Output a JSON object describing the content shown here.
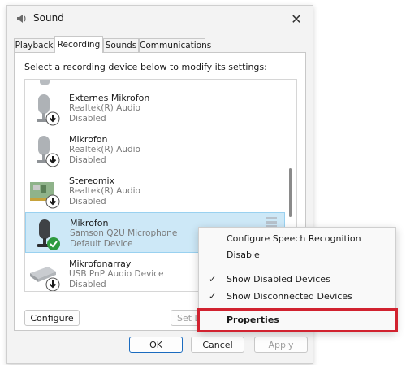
{
  "window": {
    "title": "Sound",
    "close_label": "✕"
  },
  "tabs": [
    {
      "label": "Playback"
    },
    {
      "label": "Recording"
    },
    {
      "label": "Sounds"
    },
    {
      "label": "Communications"
    }
  ],
  "instruction": "Select a recording device below to modify its settings:",
  "devices": [
    {
      "name": "Externes Mikrofon",
      "driver": "Realtek(R) Audio",
      "status": "Disabled",
      "icon": "microphone-disabled-icon"
    },
    {
      "name": "Mikrofon",
      "driver": "Realtek(R) Audio",
      "status": "Disabled",
      "icon": "microphone-disabled-icon"
    },
    {
      "name": "Stereomix",
      "driver": "Realtek(R) Audio",
      "status": "Disabled",
      "icon": "sound-card-disabled-icon"
    },
    {
      "name": "Mikrofon",
      "driver": "Samson Q2U Microphone",
      "status": "Default Device",
      "icon": "microphone-default-icon"
    },
    {
      "name": "Mikrofonarray",
      "driver": "USB PnP Audio Device",
      "status": "Disabled",
      "icon": "microphone-array-disabled-icon"
    }
  ],
  "buttons": {
    "configure": "Configure",
    "set_default": "Set D",
    "ok": "OK",
    "cancel": "Cancel",
    "apply": "Apply"
  },
  "context_menu": {
    "configure_speech": "Configure Speech Recognition",
    "disable": "Disable",
    "show_disabled": "Show Disabled Devices",
    "show_disconnected": "Show Disconnected Devices",
    "properties": "Properties",
    "check_mark": "✓"
  },
  "colors": {
    "selection": "#cde8f7",
    "highlight_box": "#d1222f",
    "default_badge": "#2e9a3f"
  }
}
